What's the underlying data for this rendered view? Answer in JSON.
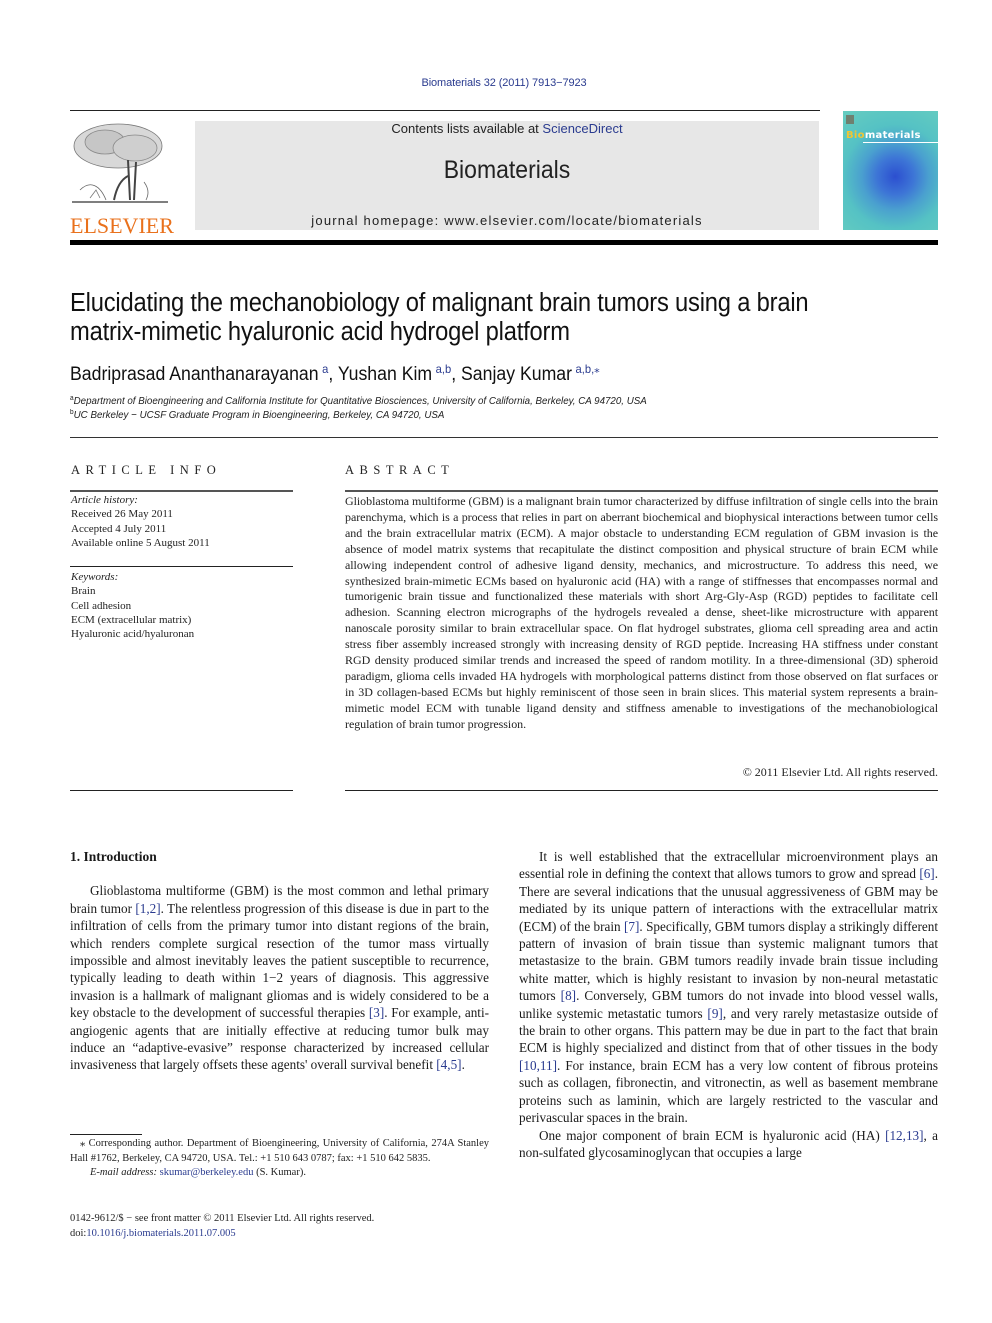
{
  "header": {
    "citation": "Biomaterials 32 (2011) 7913−7923",
    "contents_prefix": "Contents lists available at ",
    "contents_link": "ScienceDirect",
    "journal_name": "Biomaterials",
    "homepage": "journal homepage: www.elsevier.com/locate/biomaterials",
    "publisher_logo_text": "ELSEVIER",
    "cover_title_highlight": "Bio",
    "cover_title_rest": "materials",
    "colors": {
      "link": "#2a3b8f",
      "elsevier_orange": "#e9711c",
      "banner_gray": "#e7e7e7"
    }
  },
  "article": {
    "title": "Elucidating the mechanobiology of malignant brain tumors using a brain matrix-mimetic hyaluronic acid hydrogel platform",
    "authors": [
      {
        "name": "Badriprasad Ananthanarayanan",
        "sup": "a"
      },
      {
        "name": "Yushan Kim",
        "sup": "a,b"
      },
      {
        "name": "Sanjay Kumar",
        "sup": "a,b,⁎"
      }
    ],
    "affiliations": [
      {
        "sup": "a",
        "text": "Department of Bioengineering and California Institute for Quantitative Biosciences, University of California, Berkeley, CA 94720, USA"
      },
      {
        "sup": "b",
        "text": "UC Berkeley − UCSF Graduate Program in Bioengineering, Berkeley, CA 94720, USA"
      }
    ]
  },
  "article_info": {
    "heading": "ARTICLE INFO",
    "history_label": "Article history:",
    "history": [
      "Received 26 May 2011",
      "Accepted 4 July 2011",
      "Available online 5 August 2011"
    ],
    "keywords_label": "Keywords:",
    "keywords": [
      "Brain",
      "Cell adhesion",
      "ECM (extracellular matrix)",
      "Hyaluronic acid/hyaluronan"
    ]
  },
  "abstract": {
    "heading": "ABSTRACT",
    "text": "Glioblastoma multiforme (GBM) is a malignant brain tumor characterized by diffuse infiltration of single cells into the brain parenchyma, which is a process that relies in part on aberrant biochemical and biophysical interactions between tumor cells and the brain extracellular matrix (ECM). A major obstacle to understanding ECM regulation of GBM invasion is the absence of model matrix systems that recapitulate the distinct composition and physical structure of brain ECM while allowing independent control of adhesive ligand density, mechanics, and microstructure. To address this need, we synthesized brain-mimetic ECMs based on hyaluronic acid (HA) with a range of stiffnesses that encompasses normal and tumorigenic brain tissue and functionalized these materials with short Arg-Gly-Asp (RGD) peptides to facilitate cell adhesion. Scanning electron micrographs of the hydrogels revealed a dense, sheet-like microstructure with apparent nanoscale porosity similar to brain extracellular space. On flat hydrogel substrates, glioma cell spreading area and actin stress fiber assembly increased strongly with increasing density of RGD peptide. Increasing HA stiffness under constant RGD density produced similar trends and increased the speed of random motility. In a three-dimensional (3D) spheroid paradigm, glioma cells invaded HA hydrogels with morphological patterns distinct from those observed on flat surfaces or in 3D collagen-based ECMs but highly reminiscent of those seen in brain slices. This material system represents a brain-mimetic model ECM with tunable ligand density and stiffness amenable to investigations of the mechanobiological regulation of brain tumor progression.",
    "copyright": "© 2011 Elsevier Ltd. All rights reserved."
  },
  "body": {
    "section_heading": "1.  Introduction",
    "left_paragraph": [
      {
        "t": "Glioblastoma multiforme (GBM) is the most common and lethal primary brain tumor "
      },
      {
        "ref": "[1,2]"
      },
      {
        "t": ". The relentless progression of this disease is due in part to the infiltration of cells from the primary tumor into distant regions of the brain, which renders complete surgical resection of the tumor mass virtually impossible and almost inevitably leaves the patient susceptible to recurrence, typically leading to death within 1−2 years of diagnosis. This aggressive invasion is a hallmark of malignant gliomas and is widely considered to be a key obstacle to the development of successful therapies "
      },
      {
        "ref": "[3]"
      },
      {
        "t": ". For example, anti-angiogenic agents that are initially effective at reducing tumor bulk may induce an “adaptive-evasive” response characterized by increased cellular invasiveness that largely offsets these agents' overall survival benefit "
      },
      {
        "ref": "[4,5]"
      },
      {
        "t": "."
      }
    ],
    "right_paragraph_1": [
      {
        "t": "It is well established that the extracellular microenvironment plays an essential role in defining the context that allows tumors to grow and spread "
      },
      {
        "ref": "[6]"
      },
      {
        "t": ". There are several indications that the unusual aggressiveness of GBM may be mediated by its unique pattern of interactions with the extracellular matrix (ECM) of the brain "
      },
      {
        "ref": "[7]"
      },
      {
        "t": ". Specifically, GBM tumors display a strikingly different pattern of invasion of brain tissue than systemic malignant tumors that metastasize to the brain. GBM tumors readily invade brain tissue including white matter, which is highly resistant to invasion by non-neural metastatic tumors "
      },
      {
        "ref": "[8]"
      },
      {
        "t": ". Conversely, GBM tumors do not invade into blood vessel walls, unlike systemic metastatic tumors "
      },
      {
        "ref": "[9]"
      },
      {
        "t": ", and very rarely metastasize outside of the brain to other organs. This pattern may be due in part to the fact that brain ECM is highly specialized and distinct from that of other tissues in the body "
      },
      {
        "ref": "[10,11]"
      },
      {
        "t": ". For instance, brain ECM has a very low content of fibrous proteins such as collagen, fibronectin, and vitronectin, as well as basement membrane proteins such as laminin, which are largely restricted to the vascular and perivascular spaces in the brain."
      }
    ],
    "right_paragraph_2": [
      {
        "t": "One major component of brain ECM is hyaluronic acid (HA) "
      },
      {
        "ref": "[12,13]"
      },
      {
        "t": ", a non-sulfated glycosaminoglycan that occupies a large"
      }
    ]
  },
  "footnote": {
    "corresponding": "⁎ Corresponding author. Department of Bioengineering, University of California, 274A Stanley Hall #1762, Berkeley, CA 94720, USA. Tel.: +1 510 643 0787; fax: +1 510 642 5835.",
    "email_label": "E-mail address: ",
    "email": "skumar@berkeley.edu",
    "email_suffix": " (S. Kumar).",
    "front_matter": "0142-9612/$ − see front matter © 2011 Elsevier Ltd. All rights reserved.",
    "doi_label": "doi:",
    "doi": "10.1016/j.biomaterials.2011.07.005"
  }
}
